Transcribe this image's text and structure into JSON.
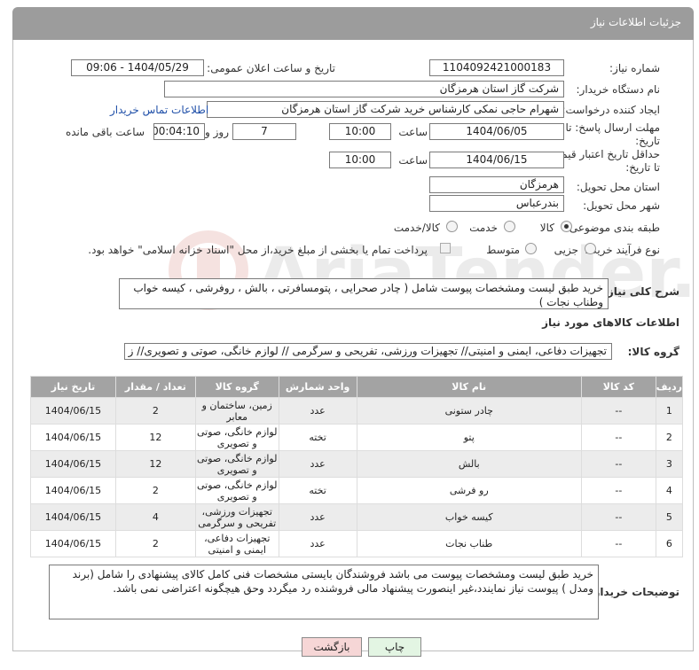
{
  "header": {
    "title": "جزئیات اطلاعات نیاز"
  },
  "fields": {
    "need_number_label": "شماره نیاز:",
    "need_number": "1104092421000183",
    "announce_label": "تاریخ و ساعت اعلان عمومی:",
    "announce_value": "1404/05/29 - 09:06",
    "buyer_org_label": "نام دستگاه خریدار:",
    "buyer_org": "شرکت گاز استان هرمزگان",
    "creator_label": "ایجاد کننده درخواست:",
    "creator": "شهرام حاجی نمکی کارشناس خرید شرکت گاز استان هرمزگان",
    "contact_link": "اطلاعات تماس خریدار",
    "deadline_label_1": "مهلت ارسال پاسخ: تا",
    "deadline_label_2": "تاریخ:",
    "deadline_date": "1404/06/05",
    "time_label": "ساعت",
    "deadline_time": "10:00",
    "days_value": "7",
    "days_label": "روز و",
    "remaining_value": "00:04:10",
    "remaining_label": "ساعت باقی مانده",
    "price_validity_label_1": "حداقل تاریخ اعتبار قیمت:",
    "price_validity_label_2": "تا تاریخ:",
    "price_validity_date": "1404/06/15",
    "price_validity_time": "10:00",
    "province_label": "استان محل تحویل:",
    "province": "هرمزگان",
    "city_label": "شهر محل تحویل:",
    "city": "بندرعباس",
    "category_label": "طبقه بندی موضوعی:",
    "category_options": [
      "کالا",
      "خدمت",
      "کالا/خدمت"
    ],
    "process_label": "نوع فرآیند خرید :",
    "process_options": [
      "جزیی",
      "متوسط"
    ],
    "payment_note": "پرداخت تمام یا بخشی از مبلغ خرید،از محل \"اسناد خزانه اسلامی\" خواهد بود.",
    "summary_label": "شرح کلی نیاز:",
    "summary": "خرید طبق لیست ومشخصات پیوست شامل ( چادر صحرایی ، پتومسافرتی ، بالش ، روفرشی ، کیسه خواب وطناب نجات )",
    "goods_info_title": "اطلاعات کالاهای مورد نیاز",
    "goods_group_label": "گروه کالا:",
    "goods_group": "تجهیزات دفاعی، ایمنی و امنیتی// تجهیزات ورزشی، تفریحی و سرگرمی // لوازم خانگی، صوتی و تصویری// ز"
  },
  "table": {
    "headers": [
      "ردیف",
      "کد کالا",
      "نام کالا",
      "واحد شمارش",
      "گروه کالا",
      "تعداد / مقدار",
      "تاریخ نیاز"
    ],
    "rows": [
      [
        "1",
        "--",
        "چادر ستونی",
        "عدد",
        "زمین، ساختمان و معابر",
        "2",
        "1404/06/15"
      ],
      [
        "2",
        "--",
        "پتو",
        "تخته",
        "لوازم خانگی، صوتی و تصویری",
        "12",
        "1404/06/15"
      ],
      [
        "3",
        "--",
        "بالش",
        "عدد",
        "لوازم خانگی، صوتی و تصویری",
        "12",
        "1404/06/15"
      ],
      [
        "4",
        "--",
        "رو فرشی",
        "تخته",
        "لوازم خانگی، صوتی و تصویری",
        "2",
        "1404/06/15"
      ],
      [
        "5",
        "--",
        "کیسه خواب",
        "عدد",
        "تجهیزات ورزشی، تفریحی و سرگرمی",
        "4",
        "1404/06/15"
      ],
      [
        "6",
        "--",
        "طناب نجات",
        "عدد",
        "تجهیزات دفاعی، ایمنی و امنیتی",
        "2",
        "1404/06/15"
      ]
    ]
  },
  "buyer_notes": {
    "label": "توضیحات خریدار:",
    "text": "خرید طبق لیست ومشخصات پیوست می باشد فروشندگان بایستی مشخصات فنی کامل کالای پیشنهادی را شامل (برند ومدل ) پیوست نیاز نمایندد،غیر اینصورت پیشنهاد مالی فروشنده رد میگردد وحق هیچگونه اعتراضی نمی باشد."
  },
  "buttons": {
    "print": "چاپ",
    "back": "بازگشت"
  },
  "colors": {
    "header_bg": "#9c9c9c",
    "link": "#1f4fa8",
    "back_btn_bg": "#f6d6d6",
    "print_btn_bg": "#e3f5e3"
  }
}
